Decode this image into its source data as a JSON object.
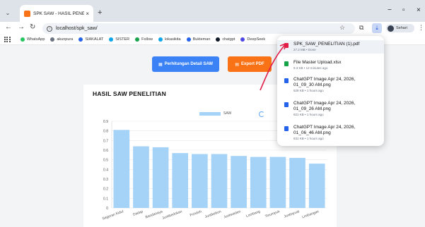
{
  "browser": {
    "tab_title": "SPK SAW - HASIL PENELITIAN",
    "url": "localhost/spk_saw/",
    "profile_name": "Sehari",
    "new_tab_label": "+",
    "tab_close": "×",
    "icons": {
      "tab_list": "chevron-down-icon",
      "back": "back-arrow-icon",
      "forward": "forward-arrow-icon",
      "reload": "reload-icon",
      "info": "info-icon",
      "bookmark_star": "star-icon",
      "extensions": "puzzle-icon",
      "download": "download-icon",
      "menu": "menu-dots-icon"
    },
    "window_controls": {
      "minimize": "−",
      "restore": "▫",
      "close": "×"
    }
  },
  "bookmarks": [
    {
      "label": "WhatsApp",
      "color": "#22c55e"
    },
    {
      "label": "akunpura",
      "color": "#6b7280"
    },
    {
      "label": "SIAKALAT",
      "color": "#2563eb"
    },
    {
      "label": "SISTER",
      "color": "#0ea5e9"
    },
    {
      "label": "Follow",
      "color": "#16a34a"
    },
    {
      "label": "lokasikita",
      "color": "#0ea5e9"
    },
    {
      "label": "Bukteman",
      "color": "#2563eb"
    },
    {
      "label": "chatgpt",
      "color": "#111827"
    },
    {
      "label": "DeepSeek",
      "color": "#4f46e5"
    }
  ],
  "page": {
    "btn_detail": "Perhitungan Detail SAW",
    "btn_export": "Export PDF",
    "card_title": "HASIL SAW PENELITIAN",
    "colors": {
      "blue_button": "#3b82f6",
      "orange_button": "#f97316",
      "bar": "#a5d3f7",
      "arrow": "#e11d48"
    }
  },
  "downloads": [
    {
      "name": "SPK_SAW_PENELITIAN (1).pdf",
      "meta": "27.2 MB • Done",
      "type": "pdf-icon",
      "color": "#e11d48"
    },
    {
      "name": "File Master Upload.xlsx",
      "meta": "9.3 KB • 12 minutes ago",
      "type": "excel-icon",
      "color": "#16a34a"
    },
    {
      "name": "ChatGPT Image Apr 24, 2026, 01_09_30 AM.png",
      "meta": "628 KB • 1 hours ago",
      "type": "image-icon",
      "color": "#2563eb"
    },
    {
      "name": "ChatGPT Image Apr 24, 2026, 01_09_26 AM.png",
      "meta": "821 KB • 1 hours ago",
      "type": "image-icon",
      "color": "#2563eb"
    },
    {
      "name": "ChatGPT Image Apr 24, 2026, 01_06_46 AM.png",
      "meta": "831 KB • 1 hours ago",
      "type": "image-icon",
      "color": "#2563eb"
    }
  ],
  "chart_data": {
    "type": "bar",
    "title": "",
    "legend": "SAW",
    "legend_position": "top-center",
    "grid": true,
    "categories": [
      "Segeran Kidul",
      "Dadap",
      "Bandanaya",
      "Juntikedokan",
      "Pondoh",
      "Juntikebon",
      "Juntiweden",
      "Lombang",
      "Tinumpuk",
      "Juntinyuat",
      "Limbangan"
    ],
    "values": [
      0.81,
      0.64,
      0.63,
      0.57,
      0.56,
      0.56,
      0.54,
      0.53,
      0.53,
      0.52,
      0.46
    ],
    "ylim": [
      0,
      0.9
    ],
    "yticks": [
      "0",
      "0.1",
      "0.2",
      "0.3",
      "0.4",
      "0.5",
      "0.6",
      "0.7",
      "0.8",
      "0.9"
    ]
  }
}
